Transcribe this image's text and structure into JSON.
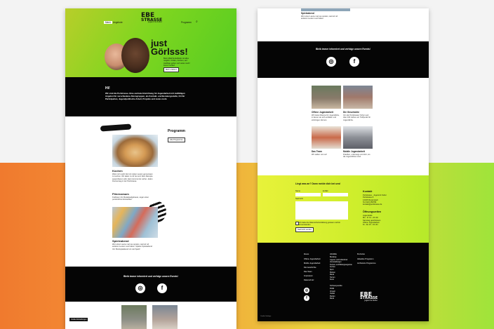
{
  "page1": {
    "nav": {
      "active": "Menü",
      "item2": "Angebote",
      "item3": "Programm",
      "search_icon": "search-icon"
    },
    "logo": {
      "line1": "EBE",
      "line2": "STRASSE",
      "sub": "Jugend & Kultur"
    },
    "hero": {
      "headline1": "just",
      "headline2": "Görlsss!",
      "text": "Beim Mädchenkollektiv ist alles möglich: Chillen, Kochen, auf Ausflüge gehen und vieles mehr! Komm vorbei!",
      "button": "Mehr erfahren"
    },
    "intro": {
      "title": "Hi!",
      "text": "Wir sind die Perlstrasse. Eine zentrale Einrichtung für Jugendarbeit mit vielfältigen Angebot für verschiedene Altersgruppen, als Kontakt- und Beratungsstelle, Ort für Partizipation, Jugendpolitische Arbeit, Projekte und vieles mehr."
    },
    "program": {
      "title": "Programm",
      "button": "Alle Programme"
    },
    "cards": [
      {
        "title": "Kochen",
        "text": "Wann ist's wahr Zeit mit vielen Leuten gemeinsam zu kochen. Wir laden zu dir bei uns! Dein Rezepte ausprobieren sollt, dann kommst du vorbei. Jeden Donnerstag in der Perlstrasse."
      },
      {
        "title": "Fitnessraum",
        "text": "Kraftraum für Muskelaufgebaute, sogar einen persönlichen Einweiblen."
      },
      {
        "title": "Spieleabend",
        "text": "Wer einen Laune mal neu spielen, weil wir all anderen Leuten Lust haben. Spielen Spieleabend Vol. Brettspielabend mit viel Spaß!"
      }
    ],
    "social": {
      "text": "Bleib immer informiert und verfolge unsere Events!"
    },
    "footer_label": "Cookie Einstellungen"
  },
  "page2": {
    "top_card": {
      "title": "Spieleabend",
      "text": "Wer einen Laune mal neu spielen, weil wir all anderen Leuten Lust haben."
    },
    "social": {
      "text": "Bleib immer informiert und verfolge unsere Events!"
    },
    "grid": [
      {
        "title": "Offene Jugendarbeit",
        "text": "Wir bieten Räume für Jugendliche, in denen sie sich entfalten und einbringen können."
      },
      {
        "title": "Die Geschichte",
        "text": "Von der Perlstrasse! Schon seit über 100 Jahren ein Treffpunkt für Jugendliche."
      },
      {
        "title": "Das Team",
        "text": "Wir stellen uns vor!"
      },
      {
        "title": "Mobile Jugendarbeit",
        "text": "Draußen, unterwegs und dort, wo die Jugendlichen sind."
      }
    ],
    "contact": {
      "title": "Liegt was an? Dann melde dich bei uns!",
      "name_label": "Name",
      "mail_label": "E-Mail",
      "message_label": "Nachricht",
      "consent": "Ich habe die Datenschutzerklärung gelesen und bin einverstanden.",
      "submit": "Nachricht senden",
      "kontakt_title": "Kontakt",
      "kontakt_lines": [
        "Perlstrasse - Jugend & Kultur",
        "Perlstrasse 8",
        "12345 Musterstadt",
        "Tel 0123 456789",
        "kontakt@perlstrasse.de"
      ],
      "hours_title": "Öffnungszeiten",
      "hours_lines": [
        "Jugendcafé",
        "Mo - Fr 14 - 20 Uhr",
        "Samstag geschlossen",
        "Offene Jugendarbeit",
        "Di - Do 15 - 19 Uhr"
      ]
    },
    "footer": {
      "col1_title": "Haus",
      "col1": [
        "Offene Jugendarbeit",
        "Mobile Jugendarbeit",
        "Die Geschichte",
        "Das Team",
        "Impressum",
        "Datenschutz"
      ],
      "col2_title": "Ablidle",
      "col2": [
        "Beratung",
        "Jugend- und Kulturarbeit",
        "Veranstaltungen",
        "Freizeit- und Bildungsangebote",
        "Kochen",
        "Sport",
        "Werken",
        "Musik",
        "Tanzen",
        "Kunst"
      ],
      "col3_title": "Kolonie",
      "col3": [
        "Aktuelles Programm",
        "Archivierte Programme"
      ],
      "col2b_title": "Schwerpunkte",
      "col2b": [
        "Politik",
        "Umwelt",
        "Vielfalt",
        "Medien",
        "Musik"
      ],
      "cookie": "Cookie Settings"
    }
  }
}
